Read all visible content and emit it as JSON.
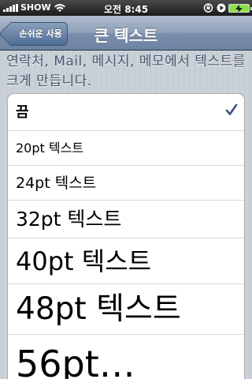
{
  "status_bar": {
    "carrier": "SHOW",
    "time": "오전 8:45",
    "icons": [
      "signal-icon",
      "wifi-icon",
      "rotation-lock-icon",
      "play-icon",
      "battery-charging-icon"
    ],
    "battery_color": "#8be24a"
  },
  "nav": {
    "back_label": "손쉬운 사용",
    "title": "큰 텍스트"
  },
  "description": "연락처, Mail, 메시지, 메모에서 텍스트를 크게 만듭니다.",
  "list": {
    "items": [
      {
        "label": "끔",
        "selected": true
      },
      {
        "label": "20pt 텍스트",
        "selected": false
      },
      {
        "label": "24pt 텍스트",
        "selected": false
      },
      {
        "label": "32pt 텍스트",
        "selected": false
      },
      {
        "label": "40pt 텍스트",
        "selected": false
      },
      {
        "label": "48pt 텍스트",
        "selected": false
      },
      {
        "label": "56pt…",
        "selected": false
      }
    ],
    "check_color": "#385487"
  }
}
